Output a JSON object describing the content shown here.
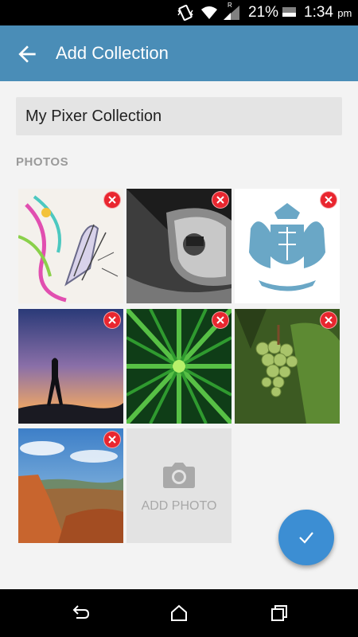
{
  "status_bar": {
    "battery_percent": "21%",
    "time": "1:34",
    "ampm": "pm",
    "network_label": "R"
  },
  "app_bar": {
    "title": "Add Collection",
    "back_icon": "arrow-back-icon"
  },
  "form": {
    "collection_name": "My Pixer Collection"
  },
  "photos": {
    "section_label": "PHOTOS",
    "items": [
      {
        "icon": "remove-icon"
      },
      {
        "icon": "remove-icon"
      },
      {
        "icon": "remove-icon"
      },
      {
        "icon": "remove-icon"
      },
      {
        "icon": "remove-icon"
      },
      {
        "icon": "remove-icon"
      },
      {
        "icon": "remove-icon"
      }
    ],
    "add_photo_label": "ADD PHOTO",
    "add_photo_icon": "camera-icon"
  },
  "fab": {
    "icon": "check-icon"
  },
  "colors": {
    "app_bar": "#4a8db7",
    "remove": "#e9262f",
    "fab": "#3c8ed3"
  }
}
